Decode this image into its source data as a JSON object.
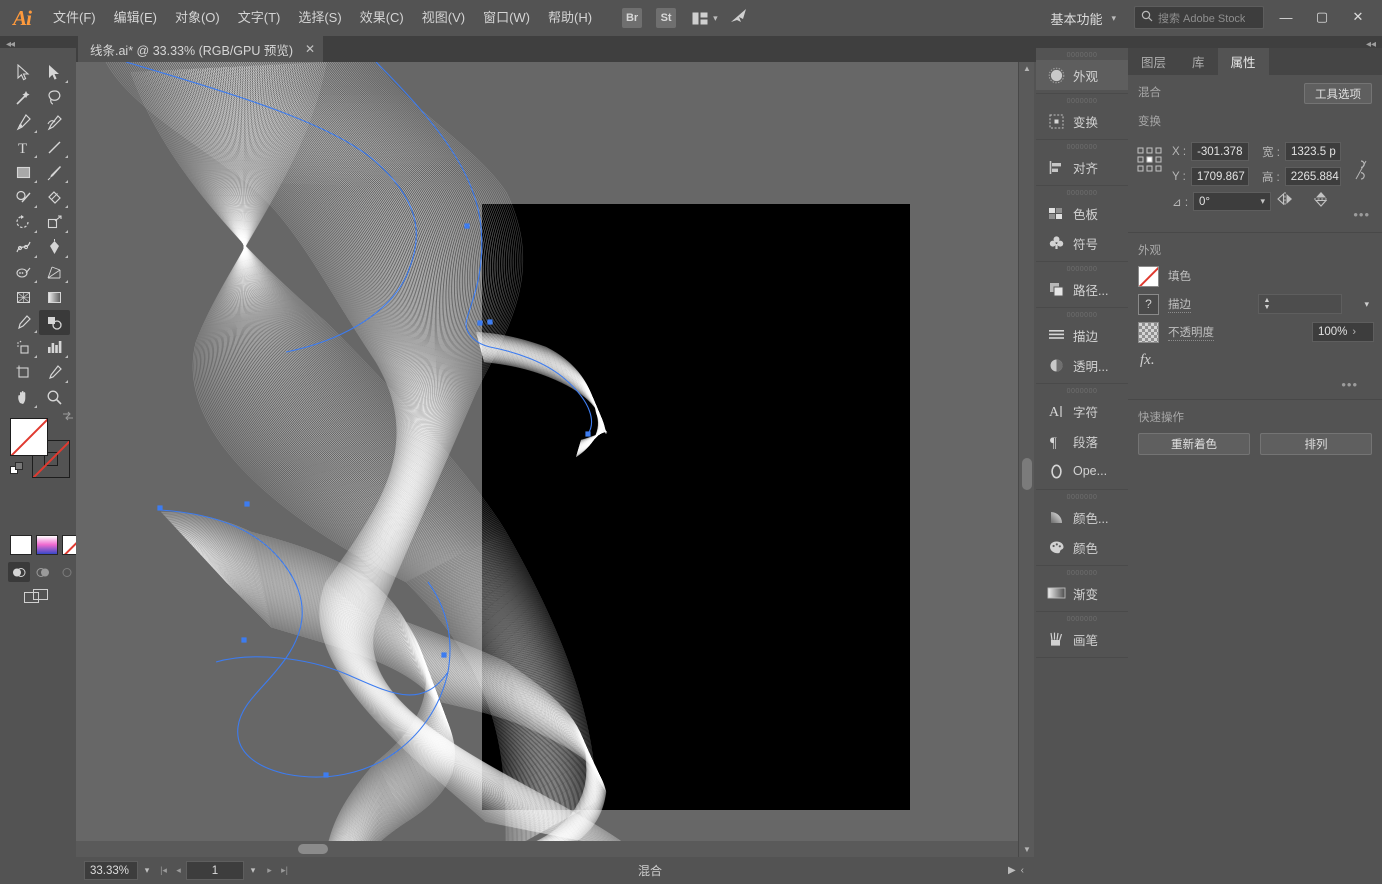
{
  "app": {
    "name": "Ai",
    "logo_color": "#ff9a3c"
  },
  "menubar": {
    "items": [
      {
        "label": "文件(F)"
      },
      {
        "label": "编辑(E)"
      },
      {
        "label": "对象(O)"
      },
      {
        "label": "文字(T)"
      },
      {
        "label": "选择(S)"
      },
      {
        "label": "效果(C)"
      },
      {
        "label": "视图(V)"
      },
      {
        "label": "窗口(W)"
      },
      {
        "label": "帮助(H)"
      }
    ],
    "bridge_label": "Br",
    "stock_label": "St",
    "arrange_icon": "arrange-documents-icon",
    "bird_icon": "illustrator-bird-icon",
    "workspace": "基本功能",
    "workspace_chevron": "▾",
    "search_icon": "search-icon",
    "search_placeholder": "搜索 Adobe Stock",
    "window_minimize": "—",
    "window_maximize": "▢",
    "window_close": "✕"
  },
  "tabbar": {
    "collapse_left": "◂◂",
    "collapse_right": "◂◂",
    "document_title": "线条.ai* @ 33.33% (RGB/GPU 预览)",
    "close": "✕"
  },
  "toolbar": {
    "tools": [
      {
        "name": "selection-tool",
        "corner": false
      },
      {
        "name": "direct-selection-tool",
        "corner": true
      },
      {
        "name": "magic-wand-tool",
        "corner": false
      },
      {
        "name": "lasso-tool",
        "corner": false
      },
      {
        "name": "pen-tool",
        "corner": true
      },
      {
        "name": "curvature-tool",
        "corner": false
      },
      {
        "name": "type-tool",
        "corner": true
      },
      {
        "name": "line-segment-tool",
        "corner": true
      },
      {
        "name": "rectangle-tool",
        "corner": true
      },
      {
        "name": "paintbrush-tool",
        "corner": true
      },
      {
        "name": "shaper-tool",
        "corner": true
      },
      {
        "name": "eraser-tool",
        "corner": true
      },
      {
        "name": "rotate-tool",
        "corner": true
      },
      {
        "name": "scale-tool",
        "corner": true
      },
      {
        "name": "width-tool",
        "corner": true
      },
      {
        "name": "free-transform-tool",
        "corner": true
      },
      {
        "name": "shape-builder-tool",
        "corner": true
      },
      {
        "name": "perspective-grid-tool",
        "corner": true
      },
      {
        "name": "mesh-tool",
        "corner": false
      },
      {
        "name": "gradient-tool",
        "corner": false
      },
      {
        "name": "eyedropper-tool",
        "corner": true
      },
      {
        "name": "blend-tool",
        "corner": false,
        "selected": true
      },
      {
        "name": "symbol-sprayer-tool",
        "corner": true
      },
      {
        "name": "column-graph-tool",
        "corner": true
      },
      {
        "name": "artboard-tool",
        "corner": false
      },
      {
        "name": "slice-tool",
        "corner": true
      },
      {
        "name": "hand-tool",
        "corner": true
      },
      {
        "name": "zoom-tool",
        "corner": false
      }
    ],
    "fill_swatch": "none",
    "stroke_swatch": "none",
    "swap_icon": "swap-fill-stroke-icon",
    "default_icon": "default-fill-stroke-icon",
    "color_mode_white": "color-swatch-white",
    "color_mode_gradient": "gradient-swatch",
    "color_mode_none": "none-swatch",
    "draw_normal": "draw-normal-icon",
    "draw_behind": "draw-behind-icon",
    "draw_inside": "draw-inside-icon",
    "screen_mode": "change-screen-mode-icon"
  },
  "canvas": {
    "artboard_background": "#000000",
    "canvas_background": "#676767",
    "selection_color": "#3d7cf0",
    "artwork_name": "blend-line-artwork",
    "artwork_description": "白色细线混合对象"
  },
  "scrollbars": {
    "v_up": "▲",
    "v_down": "▼",
    "h_left": "◂",
    "h_right": "▸"
  },
  "statusbar": {
    "zoom_level": "33.33%",
    "zoom_chevron": "▾",
    "first_page": "|◂",
    "prev_page": "◂",
    "page_number": "1",
    "page_chevron": "▾",
    "next_page": "▸",
    "last_page": "▸|",
    "tool_status": "混合",
    "play_icon": "▶",
    "expand_icon": "‹"
  },
  "dock": {
    "groups": [
      {
        "label": "0000000",
        "items": [
          {
            "label": "外观",
            "icon": "appearance-icon",
            "active": true
          }
        ]
      },
      {
        "label": "0000000",
        "items": [
          {
            "label": "变换",
            "icon": "transform-icon"
          }
        ]
      },
      {
        "label": "0000000",
        "items": [
          {
            "label": "对齐",
            "icon": "align-icon"
          }
        ]
      },
      {
        "label": "0000000",
        "items": [
          {
            "label": "色板",
            "icon": "swatches-icon"
          },
          {
            "label": "符号",
            "icon": "symbols-icon"
          }
        ]
      },
      {
        "label": "0000000",
        "items": [
          {
            "label": "路径...",
            "icon": "pathfinder-icon"
          }
        ]
      },
      {
        "label": "0000000",
        "items": [
          {
            "label": "描边",
            "icon": "stroke-icon"
          },
          {
            "label": "透明...",
            "icon": "transparency-icon"
          }
        ]
      },
      {
        "label": "0000000",
        "items": [
          {
            "label": "字符",
            "icon": "character-icon"
          },
          {
            "label": "段落",
            "icon": "paragraph-icon"
          },
          {
            "label": "Ope...",
            "icon": "opentype-icon"
          }
        ]
      },
      {
        "label": "0000000",
        "items": [
          {
            "label": "颜色...",
            "icon": "color-guide-icon"
          },
          {
            "label": "颜色",
            "icon": "color-icon"
          }
        ]
      },
      {
        "label": "0000000",
        "items": [
          {
            "label": "渐变",
            "icon": "gradient-icon"
          }
        ]
      },
      {
        "label": "0000000",
        "items": [
          {
            "label": "画笔",
            "icon": "brushes-icon"
          }
        ]
      }
    ]
  },
  "properties": {
    "tabs": [
      {
        "label": "图层",
        "active": false
      },
      {
        "label": "库",
        "active": false
      },
      {
        "label": "属性",
        "active": true
      }
    ],
    "blend_section_label": "混合",
    "tool_options_button": "工具选项",
    "transform_section_label": "变换",
    "transform": {
      "reference_point": "reference-point-grid",
      "x_label": "X :",
      "x_value": "-301.378",
      "y_label": "Y :",
      "y_value": "1709.867",
      "w_label": "宽 :",
      "w_value": "1323.5 p",
      "h_label": "高 :",
      "h_value": "2265.884",
      "angle_label": "⊿ :",
      "angle_value": "0°",
      "angle_chevron": "▾",
      "chain_icon": "constrain-proportions-icon",
      "flip_horizontal": "flip-horizontal-icon",
      "flip_vertical": "flip-vertical-icon",
      "more_options": "•••"
    },
    "appearance_section_label": "外观",
    "appearance": {
      "fill_label": "填色",
      "fill_swatch": "none",
      "stroke_label": "描边",
      "stroke_swatch": "mixed",
      "stroke_swatch_glyph": "?",
      "stroke_weight_value": "",
      "stroke_dropdown_chevron": "▾",
      "opacity_label": "不透明度",
      "opacity_value": "100%",
      "opacity_caret": "›",
      "fx_label": "fx.",
      "more_options": "•••"
    },
    "quick_actions_label": "快速操作",
    "quick_actions": [
      {
        "label": "重新着色"
      },
      {
        "label": "排列"
      }
    ]
  }
}
